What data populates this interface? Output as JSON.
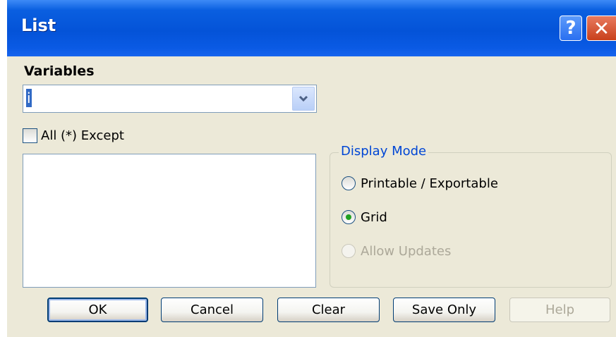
{
  "window": {
    "title": "List",
    "help_glyph": "?",
    "close_glyph": "✕"
  },
  "variables": {
    "label": "Variables",
    "selected_value": "i",
    "dropdown_icon": "chevron-down-icon"
  },
  "except_checkbox": {
    "label": "All (*) Except",
    "checked": false
  },
  "display_mode": {
    "legend": "Display Mode",
    "options": [
      {
        "label": "Printable / Exportable",
        "selected": false,
        "enabled": true
      },
      {
        "label": "Grid",
        "selected": true,
        "enabled": true
      },
      {
        "label": "Allow Updates",
        "selected": false,
        "enabled": false
      }
    ]
  },
  "buttons": {
    "ok": "OK",
    "cancel": "Cancel",
    "clear": "Clear",
    "save_only": "Save Only",
    "help": "Help"
  },
  "colors": {
    "titlebar": "#0453d8",
    "dialog_bg": "#ece9d8",
    "selection": "#316ac5",
    "group_legend": "#0046d5",
    "disabled_text": "#aca899"
  }
}
